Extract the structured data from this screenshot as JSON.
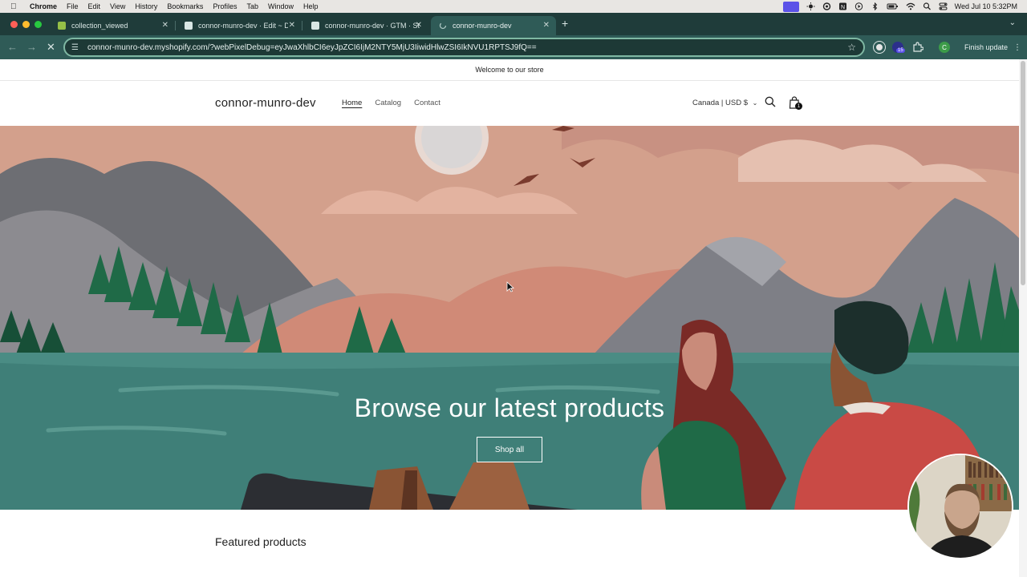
{
  "menubar": {
    "app": "Chrome",
    "items": [
      "File",
      "Edit",
      "View",
      "History",
      "Bookmarks",
      "Profiles",
      "Tab",
      "Window",
      "Help"
    ],
    "clock": "Wed Jul 10  5:32PM"
  },
  "tabs": [
    {
      "title": "collection_viewed",
      "active": false
    },
    {
      "title": "connor-munro-dev · Edit ~ D",
      "active": false
    },
    {
      "title": "connor-munro-dev · GTM · St",
      "active": false
    },
    {
      "title": "connor-munro-dev",
      "active": true
    }
  ],
  "toolbar": {
    "url": "connor-munro-dev.myshopify.com/?webPixelDebug=eyJwaXhlbCI6eyJpZCI6IjM2NTY5MjU3IiwidHlwZSI6IkNVU1RPTSJ9fQ==",
    "extension_badge": "15",
    "profile_initial": "C",
    "finish_update": "Finish update"
  },
  "store": {
    "announcement": "Welcome to our store",
    "name": "connor-munro-dev",
    "nav": [
      "Home",
      "Catalog",
      "Contact"
    ],
    "locale": "Canada | USD $",
    "cart_count": "1",
    "hero_title": "Browse our latest products",
    "hero_button": "Shop all",
    "featured_heading": "Featured products"
  },
  "colors": {
    "tab_strip": "#1f3c3a",
    "toolbar": "#2f5b57",
    "omnibox_border": "#7fb8a3",
    "sky": "#d9a58f",
    "water": "#3f7f78"
  }
}
